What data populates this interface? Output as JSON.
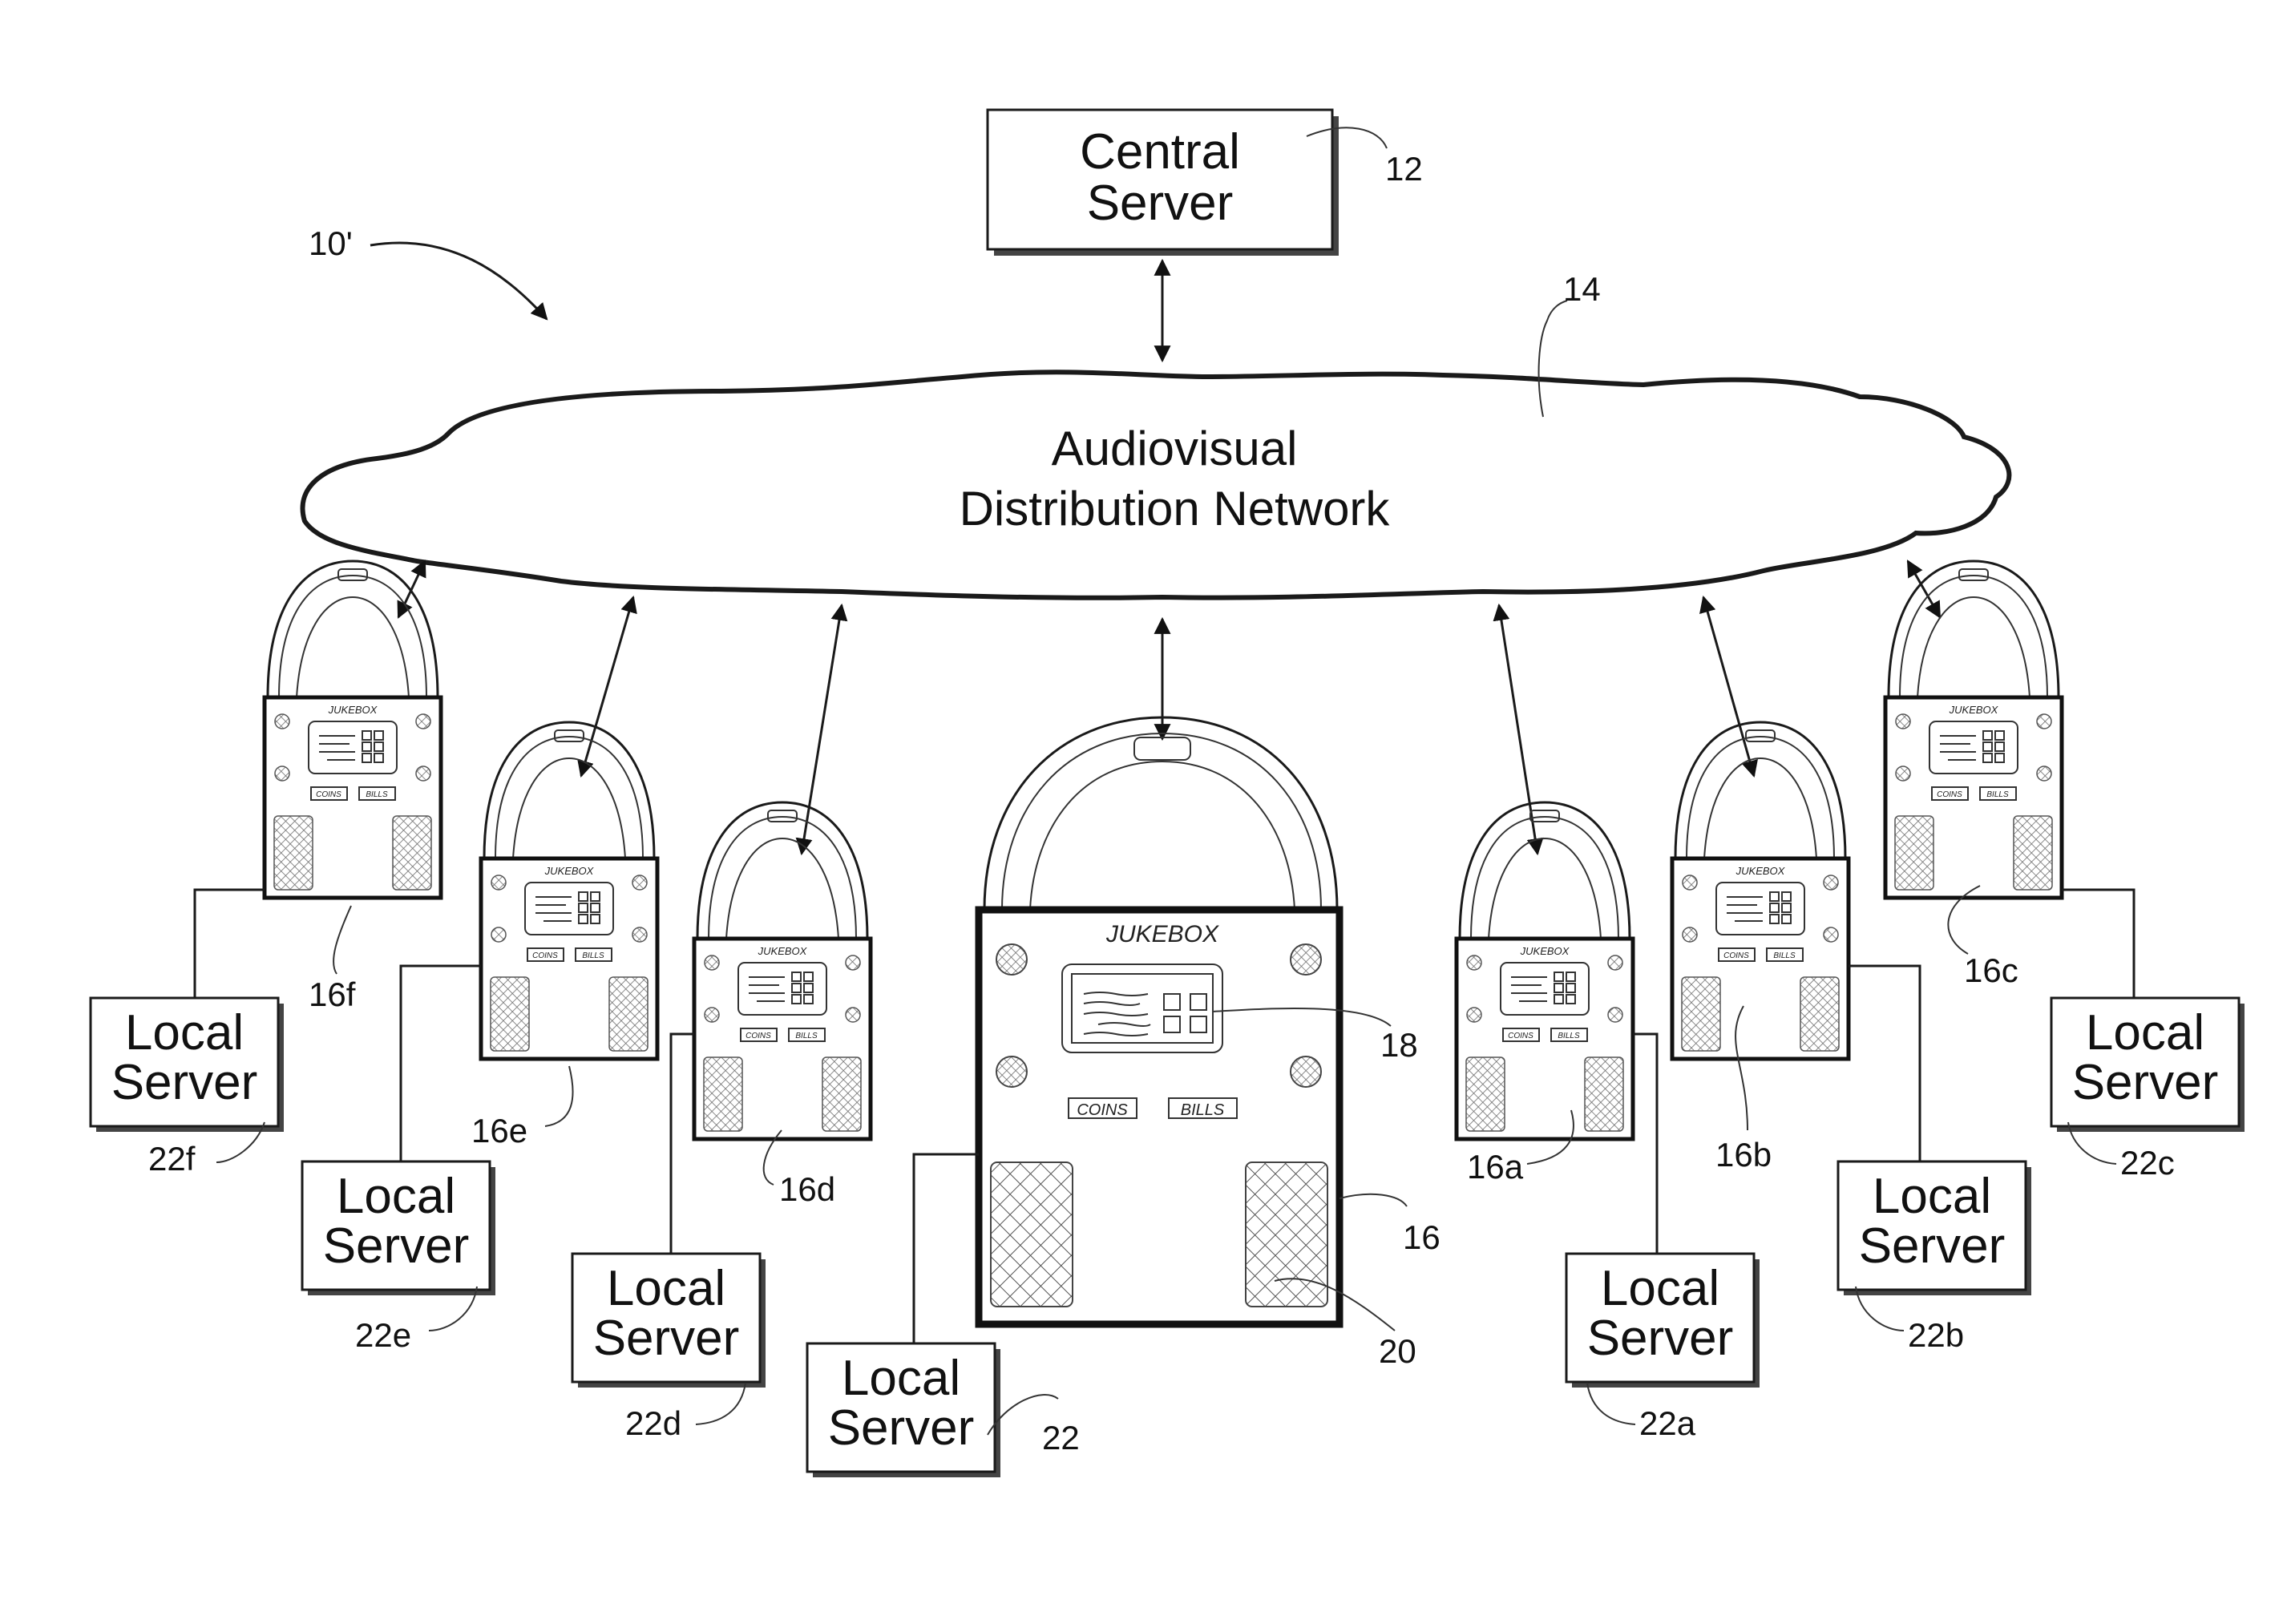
{
  "figure_label": "10'",
  "central_server": {
    "line1": "Central",
    "line2": "Server",
    "ref": "12"
  },
  "network": {
    "line1": "Audiovisual",
    "line2": "Distribution Network",
    "ref": "14"
  },
  "main_jukebox": {
    "ref": "16",
    "title": "JUKEBOX",
    "coins_label": "COINS",
    "bills_label": "BILLS",
    "display_ref": "18",
    "speaker_ref": "20",
    "local_server": {
      "line1": "Local",
      "line2": "Server",
      "ref": "22"
    }
  },
  "jukeboxes": [
    {
      "id": "16f",
      "ref": "16f",
      "title": "JUKEBOX",
      "coins_label": "COINS",
      "bills_label": "BILLS",
      "local_server": {
        "line1": "Local",
        "line2": "Server",
        "ref": "22f"
      }
    },
    {
      "id": "16e",
      "ref": "16e",
      "title": "JUKEBOX",
      "coins_label": "COINS",
      "bills_label": "BILLS",
      "local_server": {
        "line1": "Local",
        "line2": "Server",
        "ref": "22e"
      }
    },
    {
      "id": "16d",
      "ref": "16d",
      "title": "JUKEBOX",
      "coins_label": "COINS",
      "bills_label": "BILLS",
      "local_server": {
        "line1": "Local",
        "line2": "Server",
        "ref": "22d"
      }
    },
    {
      "id": "16a",
      "ref": "16a",
      "title": "JUKEBOX",
      "coins_label": "COINS",
      "bills_label": "BILLS",
      "local_server": {
        "line1": "Local",
        "line2": "Server",
        "ref": "22a"
      }
    },
    {
      "id": "16b",
      "ref": "16b",
      "title": "JUKEBOX",
      "coins_label": "COINS",
      "bills_label": "BILLS",
      "local_server": {
        "line1": "Local",
        "line2": "Server",
        "ref": "22b"
      }
    },
    {
      "id": "16c",
      "ref": "16c",
      "title": "JUKEBOX",
      "coins_label": "COINS",
      "bills_label": "BILLS",
      "local_server": {
        "line1": "Local",
        "line2": "Server",
        "ref": "22c"
      }
    }
  ]
}
